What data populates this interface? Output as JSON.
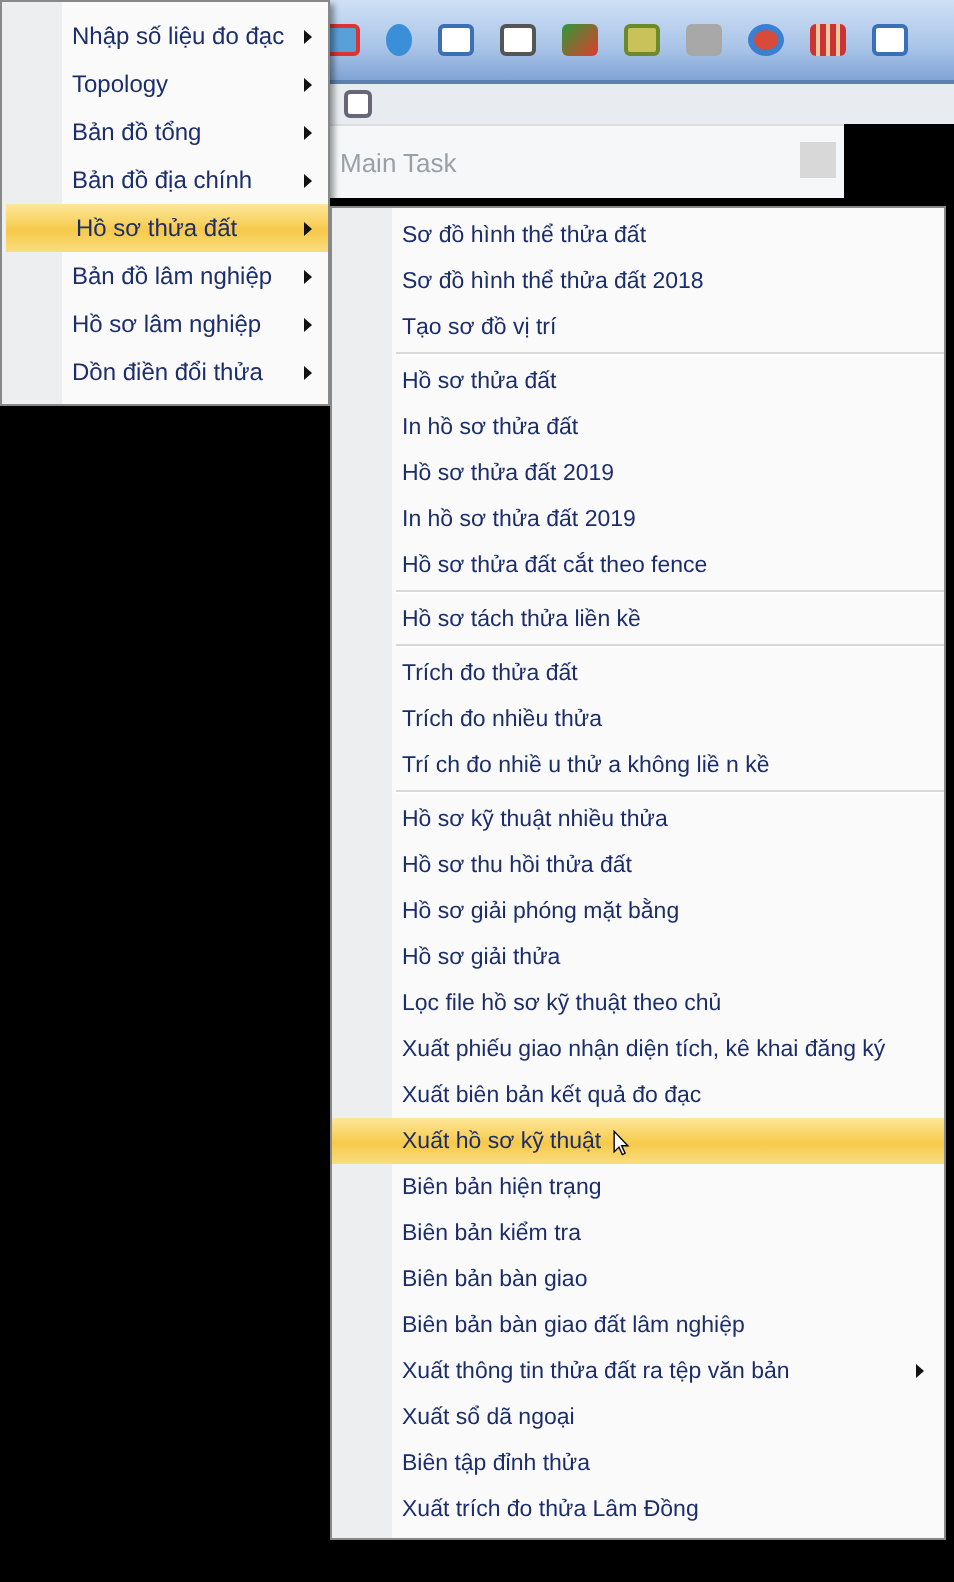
{
  "main_task": {
    "title": "Main Task"
  },
  "menu": {
    "items": [
      {
        "label": "Nhập số liệu đo đạc",
        "has_submenu": true,
        "selected": false
      },
      {
        "label": "Topology",
        "has_submenu": true,
        "selected": false
      },
      {
        "label": "Bản đồ tổng",
        "has_submenu": true,
        "selected": false
      },
      {
        "label": "Bản đồ địa chính",
        "has_submenu": true,
        "selected": false
      },
      {
        "label": "Hồ sơ thửa đất",
        "has_submenu": true,
        "selected": true
      },
      {
        "label": "Bản đồ lâm nghiệp",
        "has_submenu": true,
        "selected": false
      },
      {
        "label": "Hồ sơ lâm nghiệp",
        "has_submenu": true,
        "selected": false
      },
      {
        "label": "Dồn điền đổi thửa",
        "has_submenu": true,
        "selected": false
      }
    ]
  },
  "submenu": {
    "groups": [
      {
        "items": [
          {
            "label": "Sơ đồ hình thể thửa đất",
            "has_submenu": false,
            "selected": false
          },
          {
            "label": "Sơ đồ hình thể thửa đất 2018",
            "has_submenu": false,
            "selected": false
          },
          {
            "label": "Tạo sơ đồ vị trí",
            "has_submenu": false,
            "selected": false
          }
        ]
      },
      {
        "items": [
          {
            "label": "Hồ sơ thửa đất",
            "has_submenu": false,
            "selected": false
          },
          {
            "label": "In hồ sơ thửa đất",
            "has_submenu": false,
            "selected": false
          },
          {
            "label": "Hồ sơ thửa đất 2019",
            "has_submenu": false,
            "selected": false
          },
          {
            "label": "In hồ sơ thửa đất 2019",
            "has_submenu": false,
            "selected": false
          },
          {
            "label": "Hồ sơ thửa đất cắt theo fence",
            "has_submenu": false,
            "selected": false
          }
        ]
      },
      {
        "items": [
          {
            "label": "Hồ sơ tách thửa liền kề",
            "has_submenu": false,
            "selected": false
          }
        ]
      },
      {
        "items": [
          {
            "label": "Trích đo thửa đất",
            "has_submenu": false,
            "selected": false
          },
          {
            "label": "Trích đo nhiều thửa",
            "has_submenu": false,
            "selected": false
          },
          {
            "label": "Trí ch đo nhiề u thử a không liề n kề",
            "has_submenu": false,
            "selected": false
          }
        ]
      },
      {
        "items": [
          {
            "label": "Hồ sơ kỹ thuật nhiều thửa",
            "has_submenu": false,
            "selected": false
          },
          {
            "label": "Hồ sơ thu hồi thửa đất",
            "has_submenu": false,
            "selected": false
          },
          {
            "label": "Hồ sơ giải phóng mặt bằng",
            "has_submenu": false,
            "selected": false
          },
          {
            "label": "Hồ sơ giải thửa",
            "has_submenu": false,
            "selected": false
          },
          {
            "label": "Lọc file hồ sơ kỹ thuật theo chủ",
            "has_submenu": false,
            "selected": false
          },
          {
            "label": "Xuất phiếu giao nhận diện tích, kê khai đăng ký",
            "has_submenu": false,
            "selected": false
          },
          {
            "label": "Xuất biên bản kết quả đo đạc",
            "has_submenu": false,
            "selected": false
          },
          {
            "label": "Xuất hồ sơ kỹ thuật",
            "has_submenu": false,
            "selected": true
          },
          {
            "label": "Biên bản hiện trạng",
            "has_submenu": false,
            "selected": false
          },
          {
            "label": "Biên bản kiểm  tra",
            "has_submenu": false,
            "selected": false
          },
          {
            "label": "Biên bản bàn giao",
            "has_submenu": false,
            "selected": false
          },
          {
            "label": "Biên bản bàn giao đất lâm nghiệp",
            "has_submenu": false,
            "selected": false
          },
          {
            "label": "Xuất thông tin thửa đất ra tệp văn bản",
            "has_submenu": true,
            "selected": false
          },
          {
            "label": "Xuất sổ dã ngoại",
            "has_submenu": false,
            "selected": false
          },
          {
            "label": "Biên tập đỉnh thửa",
            "has_submenu": false,
            "selected": false
          },
          {
            "label": "Xuất trích đo thửa Lâm Đồng",
            "has_submenu": false,
            "selected": false
          }
        ]
      }
    ]
  }
}
